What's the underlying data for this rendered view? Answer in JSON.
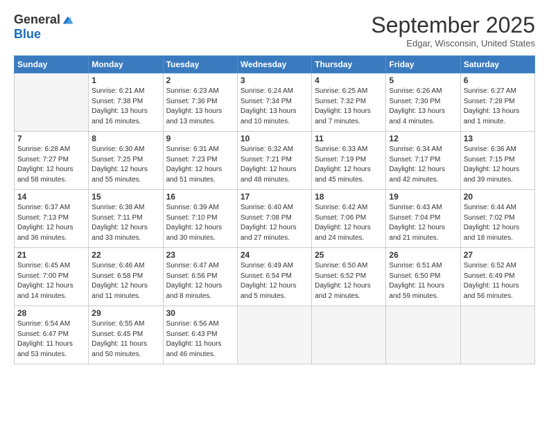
{
  "header": {
    "logo_general": "General",
    "logo_blue": "Blue",
    "title": "September 2025",
    "location": "Edgar, Wisconsin, United States"
  },
  "weekdays": [
    "Sunday",
    "Monday",
    "Tuesday",
    "Wednesday",
    "Thursday",
    "Friday",
    "Saturday"
  ],
  "weeks": [
    [
      {
        "day": "",
        "info": ""
      },
      {
        "day": "1",
        "info": "Sunrise: 6:21 AM\nSunset: 7:38 PM\nDaylight: 13 hours\nand 16 minutes."
      },
      {
        "day": "2",
        "info": "Sunrise: 6:23 AM\nSunset: 7:36 PM\nDaylight: 13 hours\nand 13 minutes."
      },
      {
        "day": "3",
        "info": "Sunrise: 6:24 AM\nSunset: 7:34 PM\nDaylight: 13 hours\nand 10 minutes."
      },
      {
        "day": "4",
        "info": "Sunrise: 6:25 AM\nSunset: 7:32 PM\nDaylight: 13 hours\nand 7 minutes."
      },
      {
        "day": "5",
        "info": "Sunrise: 6:26 AM\nSunset: 7:30 PM\nDaylight: 13 hours\nand 4 minutes."
      },
      {
        "day": "6",
        "info": "Sunrise: 6:27 AM\nSunset: 7:28 PM\nDaylight: 13 hours\nand 1 minute."
      }
    ],
    [
      {
        "day": "7",
        "info": "Sunrise: 6:28 AM\nSunset: 7:27 PM\nDaylight: 12 hours\nand 58 minutes."
      },
      {
        "day": "8",
        "info": "Sunrise: 6:30 AM\nSunset: 7:25 PM\nDaylight: 12 hours\nand 55 minutes."
      },
      {
        "day": "9",
        "info": "Sunrise: 6:31 AM\nSunset: 7:23 PM\nDaylight: 12 hours\nand 51 minutes."
      },
      {
        "day": "10",
        "info": "Sunrise: 6:32 AM\nSunset: 7:21 PM\nDaylight: 12 hours\nand 48 minutes."
      },
      {
        "day": "11",
        "info": "Sunrise: 6:33 AM\nSunset: 7:19 PM\nDaylight: 12 hours\nand 45 minutes."
      },
      {
        "day": "12",
        "info": "Sunrise: 6:34 AM\nSunset: 7:17 PM\nDaylight: 12 hours\nand 42 minutes."
      },
      {
        "day": "13",
        "info": "Sunrise: 6:36 AM\nSunset: 7:15 PM\nDaylight: 12 hours\nand 39 minutes."
      }
    ],
    [
      {
        "day": "14",
        "info": "Sunrise: 6:37 AM\nSunset: 7:13 PM\nDaylight: 12 hours\nand 36 minutes."
      },
      {
        "day": "15",
        "info": "Sunrise: 6:38 AM\nSunset: 7:11 PM\nDaylight: 12 hours\nand 33 minutes."
      },
      {
        "day": "16",
        "info": "Sunrise: 6:39 AM\nSunset: 7:10 PM\nDaylight: 12 hours\nand 30 minutes."
      },
      {
        "day": "17",
        "info": "Sunrise: 6:40 AM\nSunset: 7:08 PM\nDaylight: 12 hours\nand 27 minutes."
      },
      {
        "day": "18",
        "info": "Sunrise: 6:42 AM\nSunset: 7:06 PM\nDaylight: 12 hours\nand 24 minutes."
      },
      {
        "day": "19",
        "info": "Sunrise: 6:43 AM\nSunset: 7:04 PM\nDaylight: 12 hours\nand 21 minutes."
      },
      {
        "day": "20",
        "info": "Sunrise: 6:44 AM\nSunset: 7:02 PM\nDaylight: 12 hours\nand 18 minutes."
      }
    ],
    [
      {
        "day": "21",
        "info": "Sunrise: 6:45 AM\nSunset: 7:00 PM\nDaylight: 12 hours\nand 14 minutes."
      },
      {
        "day": "22",
        "info": "Sunrise: 6:46 AM\nSunset: 6:58 PM\nDaylight: 12 hours\nand 11 minutes."
      },
      {
        "day": "23",
        "info": "Sunrise: 6:47 AM\nSunset: 6:56 PM\nDaylight: 12 hours\nand 8 minutes."
      },
      {
        "day": "24",
        "info": "Sunrise: 6:49 AM\nSunset: 6:54 PM\nDaylight: 12 hours\nand 5 minutes."
      },
      {
        "day": "25",
        "info": "Sunrise: 6:50 AM\nSunset: 6:52 PM\nDaylight: 12 hours\nand 2 minutes."
      },
      {
        "day": "26",
        "info": "Sunrise: 6:51 AM\nSunset: 6:50 PM\nDaylight: 11 hours\nand 59 minutes."
      },
      {
        "day": "27",
        "info": "Sunrise: 6:52 AM\nSunset: 6:49 PM\nDaylight: 11 hours\nand 56 minutes."
      }
    ],
    [
      {
        "day": "28",
        "info": "Sunrise: 6:54 AM\nSunset: 6:47 PM\nDaylight: 11 hours\nand 53 minutes."
      },
      {
        "day": "29",
        "info": "Sunrise: 6:55 AM\nSunset: 6:45 PM\nDaylight: 11 hours\nand 50 minutes."
      },
      {
        "day": "30",
        "info": "Sunrise: 6:56 AM\nSunset: 6:43 PM\nDaylight: 11 hours\nand 46 minutes."
      },
      {
        "day": "",
        "info": ""
      },
      {
        "day": "",
        "info": ""
      },
      {
        "day": "",
        "info": ""
      },
      {
        "day": "",
        "info": ""
      }
    ]
  ]
}
